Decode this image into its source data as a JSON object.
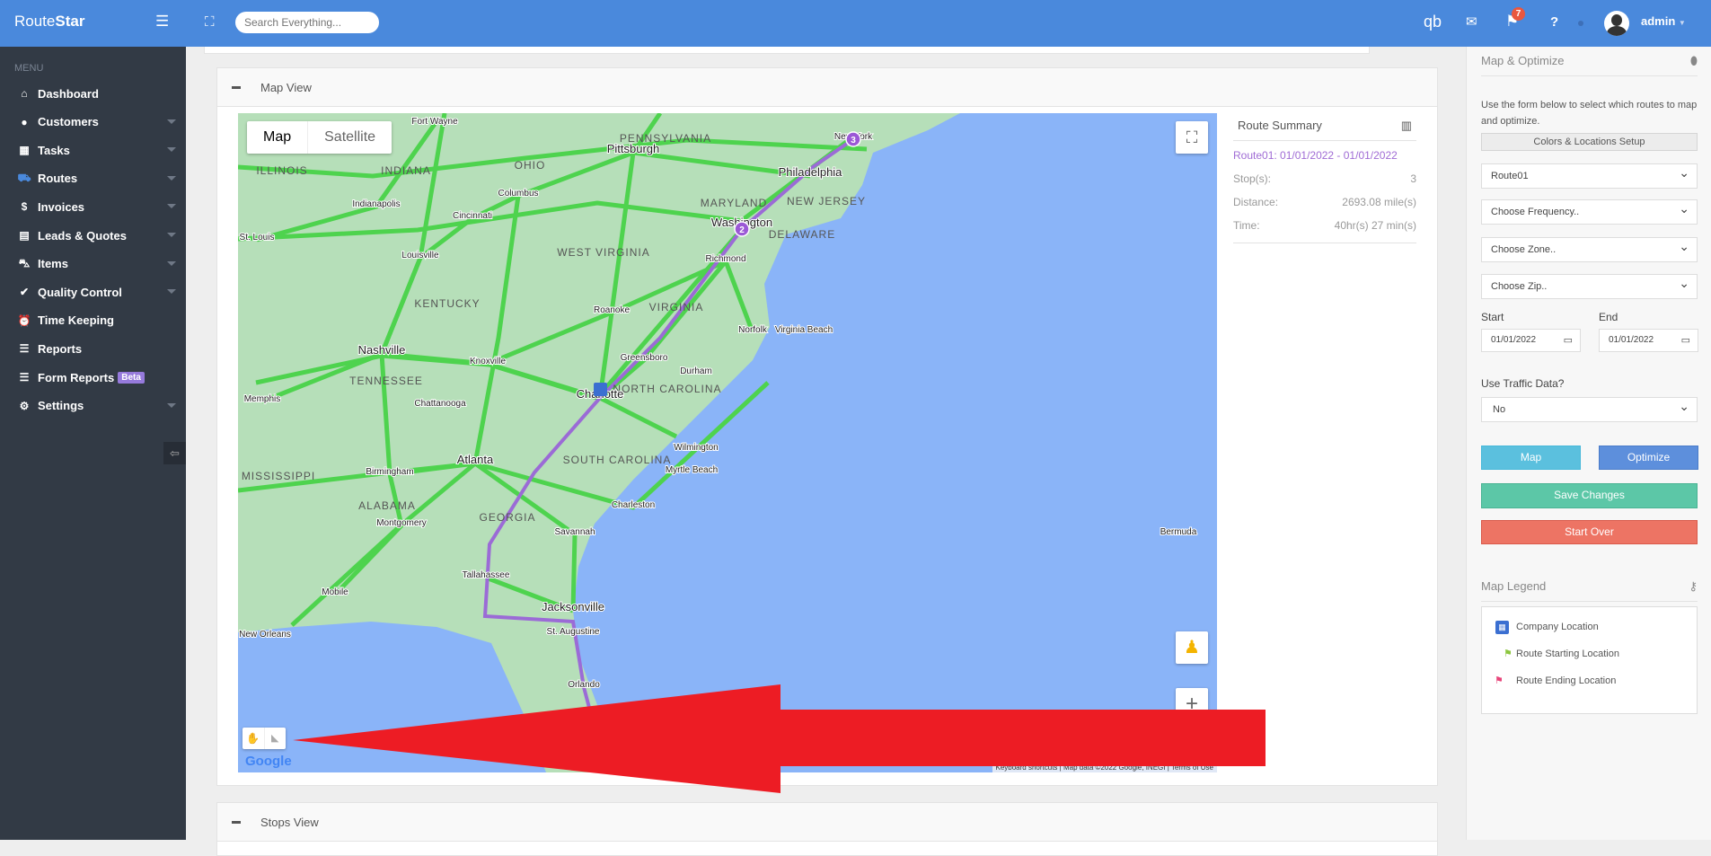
{
  "topbar": {
    "brand_a": "Route",
    "brand_b": "Star",
    "search_placeholder": "Search Everything...",
    "notification_count": "7",
    "user": "admin"
  },
  "sidebar": {
    "menu_label": "MENU",
    "items": [
      {
        "label": "Dashboard",
        "icon": "home-icon",
        "glyph": "⌂",
        "caret": false
      },
      {
        "label": "Customers",
        "icon": "user-icon",
        "glyph": "●",
        "caret": true
      },
      {
        "label": "Tasks",
        "icon": "calendar-icon",
        "glyph": "▦",
        "caret": true
      },
      {
        "label": "Routes",
        "icon": "truck-icon",
        "glyph": "⛟",
        "caret": true
      },
      {
        "label": "Invoices",
        "icon": "dollar-icon",
        "glyph": "$",
        "caret": true
      },
      {
        "label": "Leads & Quotes",
        "icon": "file-icon",
        "glyph": "▤",
        "caret": true
      },
      {
        "label": "Items",
        "icon": "cart-icon",
        "glyph": "⛍",
        "caret": true
      },
      {
        "label": "Quality Control",
        "icon": "user-check-icon",
        "glyph": "✔",
        "caret": true
      },
      {
        "label": "Time Keeping",
        "icon": "alarm-clock-icon",
        "glyph": "⏰",
        "caret": false
      },
      {
        "label": "Reports",
        "icon": "list-icon",
        "glyph": "☰",
        "caret": false
      },
      {
        "label": "Form Reports",
        "icon": "list-icon",
        "glyph": "☰",
        "caret": false,
        "badge": "Beta"
      },
      {
        "label": "Settings",
        "icon": "gear-icon",
        "glyph": "⚙",
        "caret": true
      }
    ]
  },
  "map_panel": {
    "title": "Map View",
    "map_type": [
      "Map",
      "Satellite"
    ],
    "footer": [
      "Keyboard shortcuts",
      "Map data ©2022 Google, INEGI",
      "Terms of Use"
    ],
    "google": "Google",
    "labels": [
      "Fort Wayne",
      "ILLINOIS",
      "INDIANA",
      "OHIO",
      "PENNSYLVANIA",
      "Pittsburgh",
      "New York",
      "Philadelphia",
      "MARYLAND",
      "NEW JERSEY",
      "Washington",
      "DELAWARE",
      "Indianapolis",
      "Columbus",
      "Cincinnati",
      "St. Louis",
      "Louisville",
      "WEST VIRGINIA",
      "KENTUCKY",
      "VIRGINIA",
      "Richmond",
      "Roanoke",
      "Norfolk",
      "Virginia Beach",
      "Nashville",
      "Knoxville",
      "Greensboro",
      "Durham",
      "TENNESSEE",
      "NORTH CAROLINA",
      "Memphis",
      "Chattanooga",
      "Charlotte",
      "Wilmington",
      "MISSISSIPPI",
      "Birmingham",
      "Atlanta",
      "SOUTH CAROLINA",
      "Myrtle Beach",
      "ALABAMA",
      "Charleston",
      "GEORGIA",
      "Montgomery",
      "Savannah",
      "Bermuda",
      "Mobile",
      "Tallahassee",
      "Jacksonville",
      "New Orleans",
      "St. Augustine",
      "Orlando"
    ],
    "markers": [
      "2",
      "3"
    ],
    "route_color": "#9b6bd6"
  },
  "route_summary": {
    "title": "Route Summary",
    "route": "Route01: 01/01/2022 - 01/01/2022",
    "rows": [
      {
        "k": "Stop(s):",
        "v": "3"
      },
      {
        "k": "Distance:",
        "v": "2693.08 mile(s)"
      },
      {
        "k": "Time:",
        "v": "40hr(s) 27 min(s)"
      }
    ]
  },
  "stops_panel": {
    "title": "Stops View"
  },
  "right": {
    "title": "Map & Optimize",
    "desc": "Use the form below to select which routes to map and optimize.",
    "colors_btn": "Colors & Locations Setup",
    "route_select": "Route01",
    "frequency": "Choose Frequency..",
    "zone": "Choose Zone..",
    "zip": "Choose Zip..",
    "start_label": "Start",
    "end_label": "End",
    "start": "01/01/2022",
    "end": "01/01/2022",
    "traffic_label": "Use Traffic Data?",
    "traffic": "No",
    "map_btn": "Map",
    "optimize_btn": "Optimize",
    "save_btn": "Save Changes",
    "startover_btn": "Start Over",
    "legend_title": "Map Legend",
    "legend": [
      "Company Location",
      "Route Starting Location",
      "Route Ending Location"
    ]
  },
  "colors": {
    "topbar": "#4a89dc",
    "sidebar": "#323a45",
    "map_btn": "#5bc0de",
    "optimize_btn": "#5d8fdc",
    "save_btn": "#5cc7a7",
    "startover_btn": "#ed7464",
    "arrow": "#ed1c24"
  }
}
